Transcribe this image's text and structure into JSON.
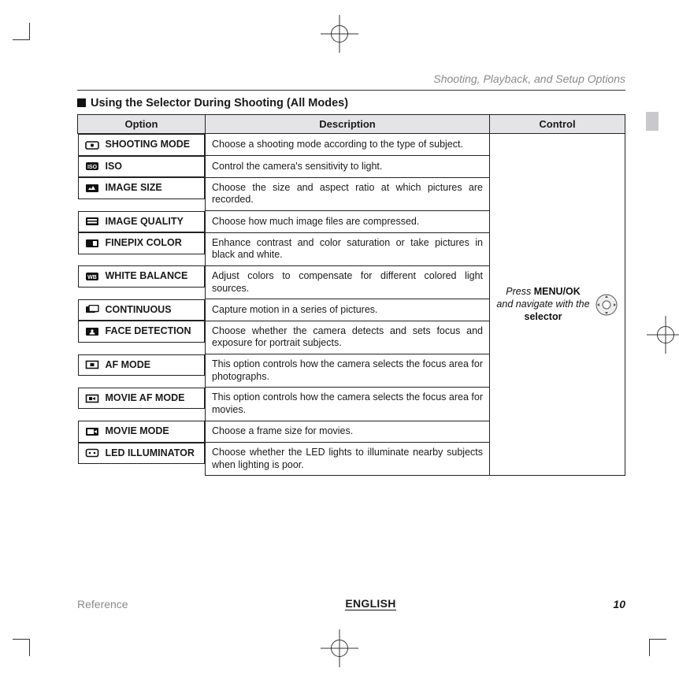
{
  "running_head": "Shooting, Playback, and Setup Options",
  "section_title": "Using the Selector During Shooting (All Modes)",
  "headers": {
    "option": "Option",
    "description": "Description",
    "control": "Control"
  },
  "rows": [
    {
      "option": "SHOOTING MODE",
      "desc": "Choose a shooting mode according to the type of subject."
    },
    {
      "option": "ISO",
      "desc": "Control the camera's sensitivity to light."
    },
    {
      "option": "IMAGE SIZE",
      "desc": "Choose the size and aspect ratio at which pictures are recorded."
    },
    {
      "option": "IMAGE QUALITY",
      "desc": "Choose how much image files are compressed."
    },
    {
      "option": "FINEPIX COLOR",
      "desc": "Enhance contrast and color saturation or take pictures in black and white."
    },
    {
      "option": "WHITE BALANCE",
      "desc": "Adjust colors to compensate for different colored light sources."
    },
    {
      "option": "CONTINUOUS",
      "desc": "Capture motion in a series of pictures."
    },
    {
      "option": "FACE DETECTION",
      "desc": "Choose whether the camera detects and sets focus and exposure for portrait subjects."
    },
    {
      "option": "AF MODE",
      "desc": "This option controls how the camera selects the focus area for photographs."
    },
    {
      "option": "MOVIE AF MODE",
      "desc": "This option controls how the camera selects the focus area for movies."
    },
    {
      "option": "MOVIE MODE",
      "desc": "Choose a frame size for movies."
    },
    {
      "option": "LED ILLUMINATOR",
      "desc": "Choose whether the LED lights to illuminate nearby subjects when lighting is poor."
    }
  ],
  "control": {
    "pre": "Press ",
    "btn": "MENU/OK",
    "mid": " and navigate with the ",
    "post": "selector"
  },
  "footer": {
    "left": "Reference",
    "center": "ENGLISH",
    "right": "10"
  }
}
